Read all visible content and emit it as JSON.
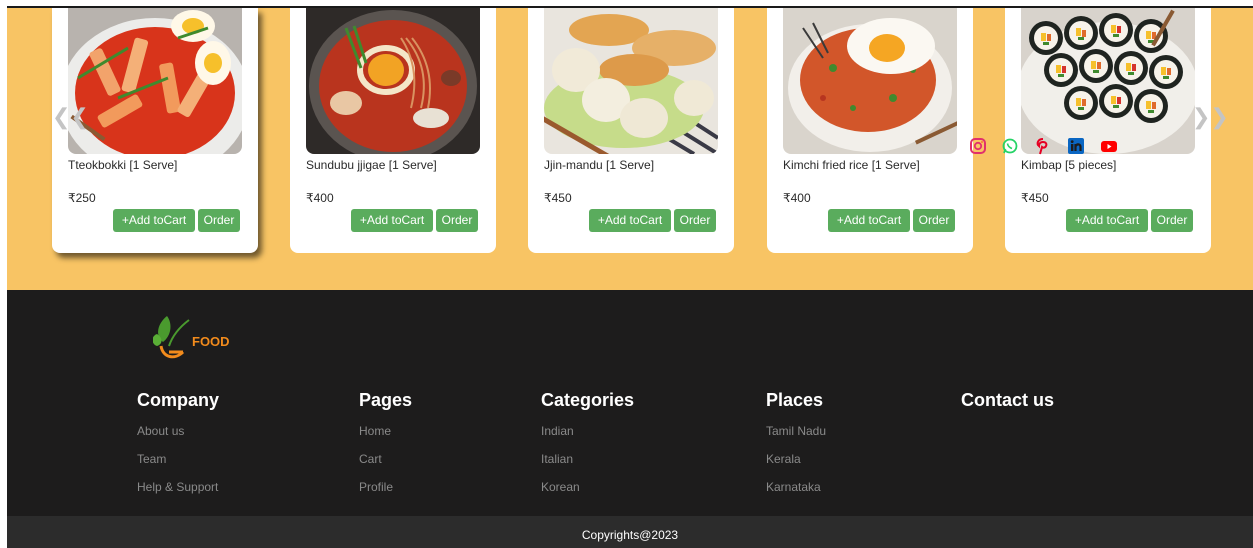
{
  "menu": {
    "cards": [
      {
        "name": "Tteokbokki [1 Serve]",
        "price": "₹250",
        "add_label": "+Add toCart",
        "order_label": "Order"
      },
      {
        "name": "Sundubu jjigae [1 Serve]",
        "price": "₹400",
        "add_label": "+Add toCart",
        "order_label": "Order"
      },
      {
        "name": "Jjin-mandu [1 Serve]",
        "price": "₹450",
        "add_label": "+Add toCart",
        "order_label": "Order"
      },
      {
        "name": "Kimchi fried rice [1 Serve]",
        "price": "₹400",
        "add_label": "+Add toCart",
        "order_label": "Order"
      },
      {
        "name": "Kimbap [5 pieces]",
        "price": "₹450",
        "add_label": "+Add toCart",
        "order_label": "Order"
      }
    ],
    "prev_arrow": "❮❮",
    "next_arrow": "❯❯"
  },
  "footer": {
    "logo_text": "FOOD",
    "company": {
      "title": "Company",
      "items": [
        "About us",
        "Team",
        "Help & Support"
      ]
    },
    "pages": {
      "title": "Pages",
      "items": [
        "Home",
        "Cart",
        "Profile"
      ]
    },
    "categories": {
      "title": "Categories",
      "items": [
        "Indian",
        "Italian",
        "Korean"
      ]
    },
    "places": {
      "title": "Places",
      "items": [
        "Tamil Nadu",
        "Kerala",
        "Karnataka"
      ]
    },
    "contact": {
      "title": "Contact us",
      "socials": [
        "instagram-icon",
        "whatsapp-icon",
        "pinterest-icon",
        "linkedin-icon",
        "youtube-icon"
      ]
    },
    "copyright": "Copyrights@2023"
  },
  "colors": {
    "section_bg": "#f8c464",
    "button_green": "#5aac5d",
    "footer_bg": "#1d1c1c",
    "copyright_bg": "#2c2c2c",
    "logo_orange": "#f28b1c"
  }
}
